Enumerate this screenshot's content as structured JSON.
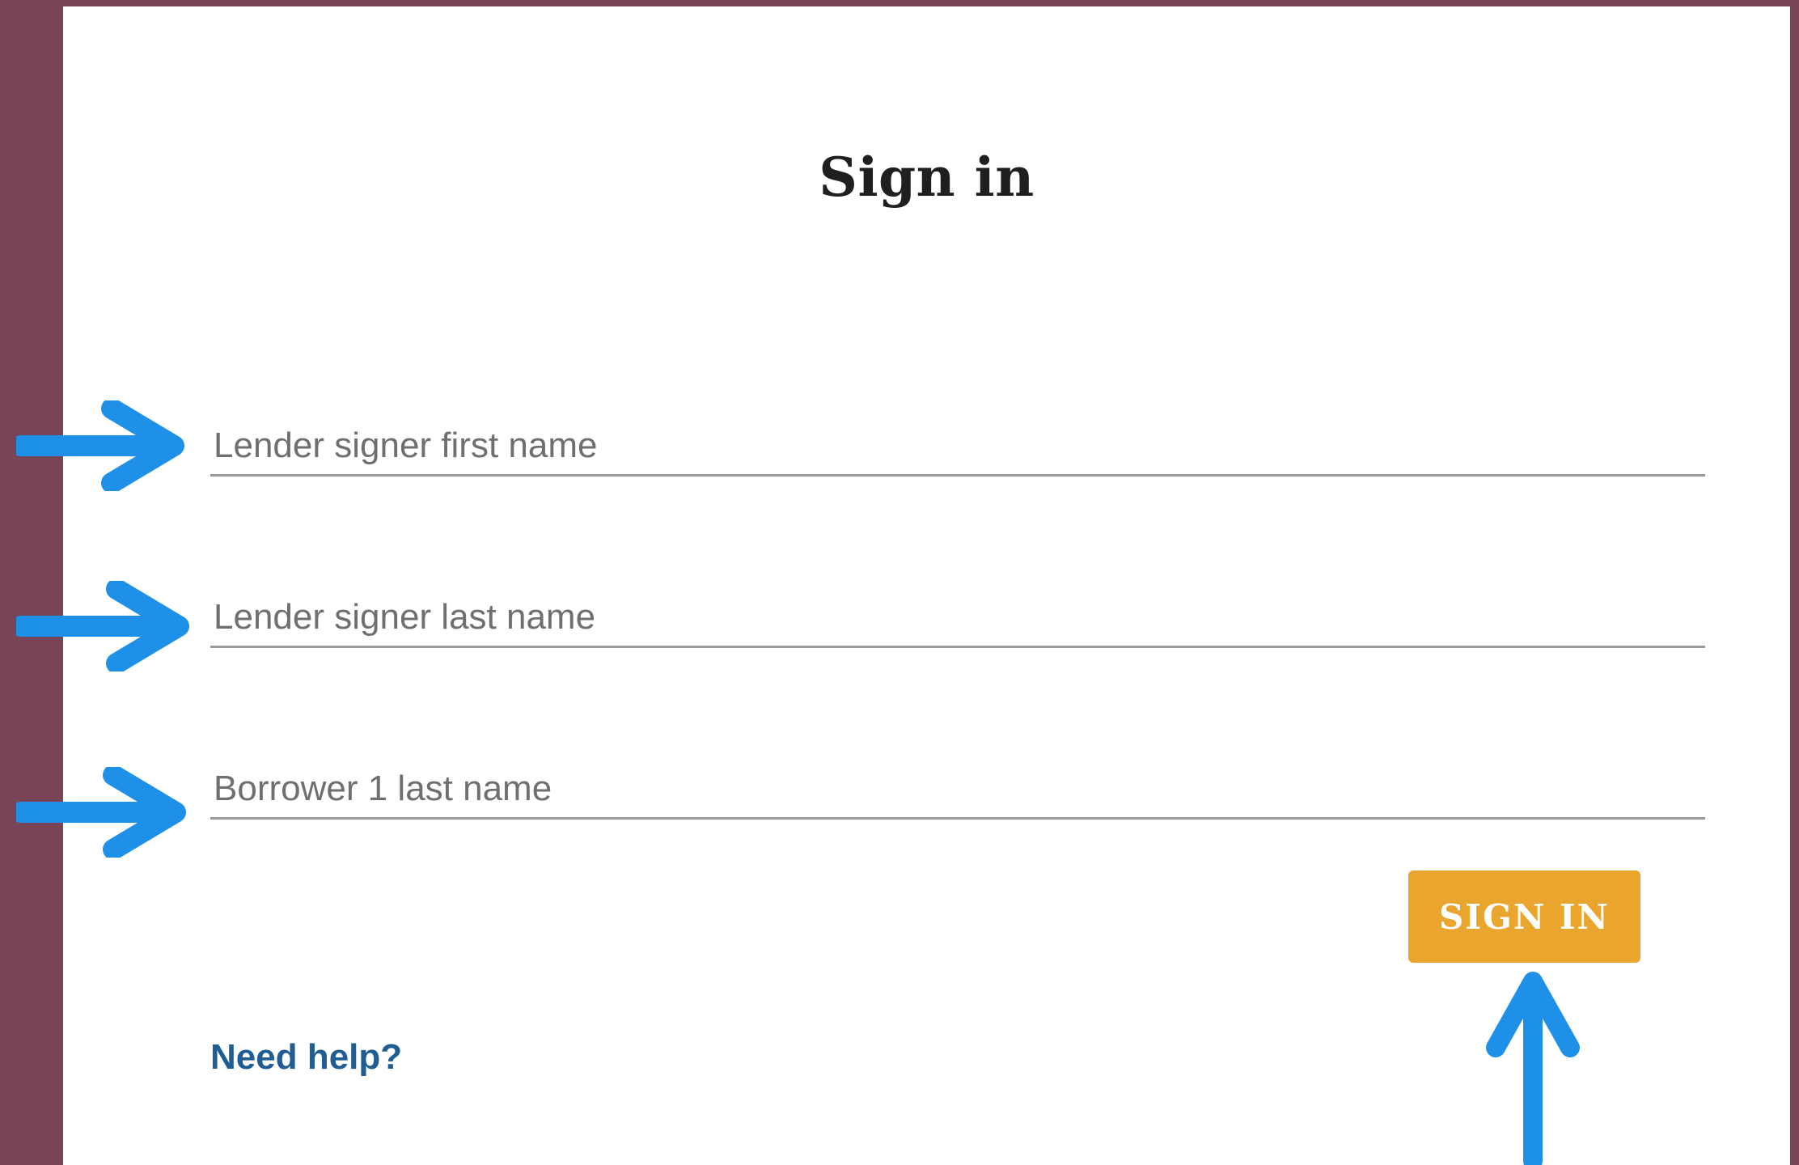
{
  "title": "Sign in",
  "fields": {
    "first_name": {
      "placeholder": "Lender signer first name",
      "value": ""
    },
    "last_name": {
      "placeholder": "Lender signer last name",
      "value": ""
    },
    "borrower_last_name": {
      "placeholder": "Borrower 1 last name",
      "value": ""
    }
  },
  "button": {
    "label": "SIGN IN"
  },
  "help": {
    "label": "Need help?"
  },
  "colors": {
    "accent": "#e9a52e",
    "frame": "#7a4458",
    "link": "#1f5d93",
    "annotation_arrow": "#1e90e8"
  },
  "annotations": [
    {
      "icon": "right-arrow-icon"
    },
    {
      "icon": "right-arrow-icon"
    },
    {
      "icon": "right-arrow-icon"
    },
    {
      "icon": "up-arrow-icon"
    }
  ]
}
